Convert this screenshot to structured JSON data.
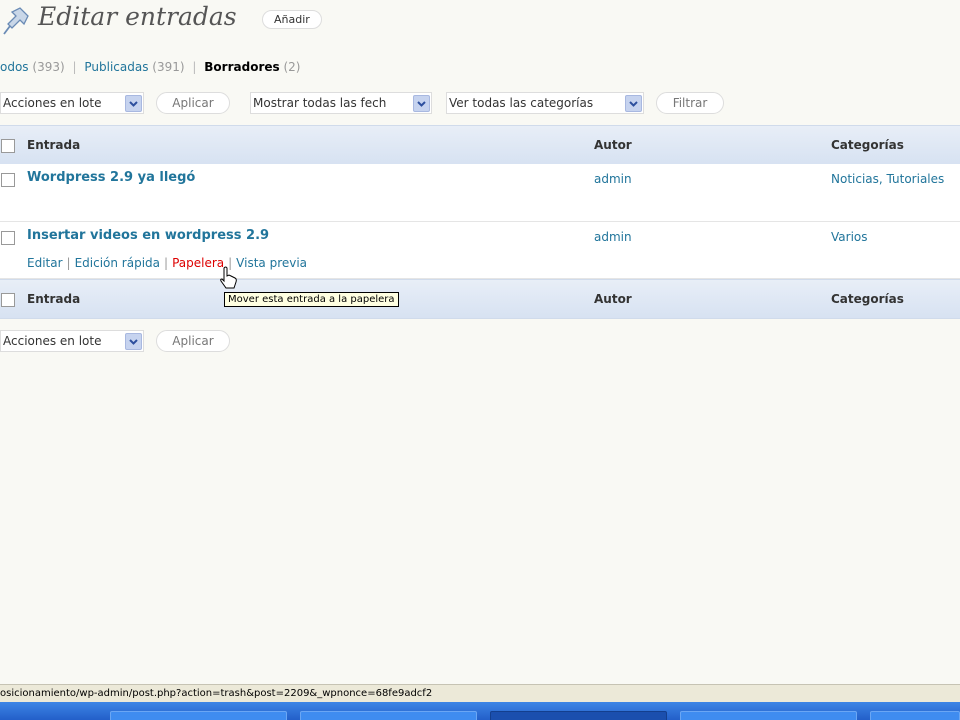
{
  "header": {
    "title": "Editar entradas",
    "add_label": "Añadir"
  },
  "filters": [
    {
      "label": "odos",
      "count": "(393)"
    },
    {
      "label": "Publicadas",
      "count": "(391)"
    },
    {
      "label": "Borradores",
      "count": "(2)"
    }
  ],
  "top_nav": {
    "bulk_actions": "Acciones en lote",
    "apply": "Aplicar",
    "dates": "Mostrar todas las fech",
    "categories": "Ver todas las categorías",
    "filter": "Filtrar"
  },
  "table": {
    "columns": {
      "title": "Entrada",
      "author": "Autor",
      "categories": "Categorías"
    },
    "rows": [
      {
        "title": "Wordpress 2.9 ya llegó",
        "author": "admin",
        "categories": "Noticias, Tutoriales"
      },
      {
        "title": "Insertar videos en wordpress 2.9",
        "author": "admin",
        "categories": "Varios"
      }
    ],
    "row_actions": {
      "edit": "Editar",
      "quick_edit": "Edición rápida",
      "trash": "Papelera",
      "preview": "Vista previa"
    }
  },
  "bottom_nav": {
    "bulk_actions": "Acciones en lote",
    "apply": "Aplicar"
  },
  "tooltip": "Mover esta entrada a la papelera",
  "status_url": "osicionamiento/wp-admin/post.php?action=trash&post=2209&_wpnonce=68fe9adcf2",
  "colors": {
    "link": "#21759b",
    "trash": "#dd0000",
    "header_bg": "#e3eaf5",
    "taskbar": "#2a68d4"
  }
}
